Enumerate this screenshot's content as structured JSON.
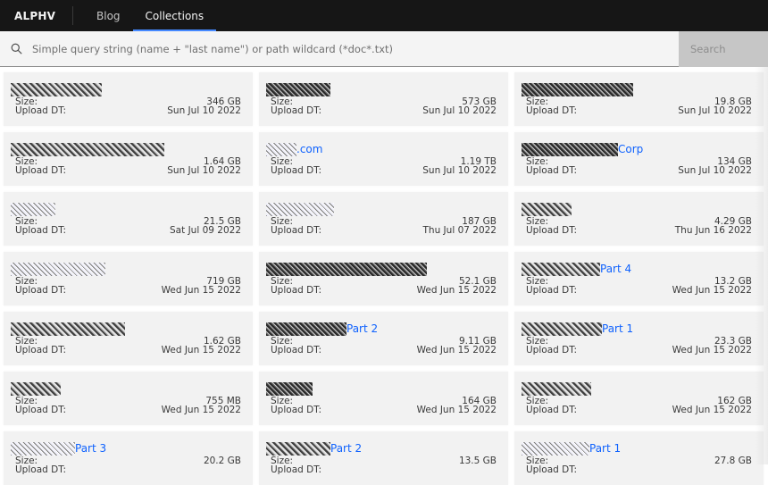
{
  "header": {
    "brand": "ALPHV",
    "nav": [
      {
        "label": "Blog",
        "active": false
      },
      {
        "label": "Collections",
        "active": true
      }
    ],
    "accent_color": "#4589ff"
  },
  "search": {
    "icon": "search-icon",
    "placeholder": "Simple query string (name + \"last name\") or path wildcard (*doc*.txt)",
    "value": "",
    "button_label": "Search"
  },
  "labels": {
    "size": "Size:",
    "upload": "Upload DT:"
  },
  "collections": [
    {
      "name_redacted": true,
      "suffix": "",
      "size": "346 GB",
      "upload": "Sun Jul 10 2022"
    },
    {
      "name_redacted": true,
      "suffix": "",
      "size": "573 GB",
      "upload": "Sun Jul 10 2022"
    },
    {
      "name_redacted": true,
      "suffix": "",
      "size": "19.8 GB",
      "upload": "Sun Jul 10 2022"
    },
    {
      "name_redacted": true,
      "suffix": "",
      "size": "1.64 GB",
      "upload": "Sun Jul 10 2022"
    },
    {
      "name_redacted": true,
      "suffix": ".com",
      "size": "1.19 TB",
      "upload": "Sun Jul 10 2022"
    },
    {
      "name_redacted": true,
      "suffix": "Corp",
      "size": "134 GB",
      "upload": "Sun Jul 10 2022"
    },
    {
      "name_redacted": true,
      "suffix": "",
      "size": "21.5 GB",
      "upload": "Sat Jul 09 2022"
    },
    {
      "name_redacted": true,
      "suffix": "",
      "size": "187 GB",
      "upload": "Thu Jul 07 2022"
    },
    {
      "name_redacted": true,
      "suffix": "",
      "size": "4.29 GB",
      "upload": "Thu Jun 16 2022"
    },
    {
      "name_redacted": true,
      "suffix": "",
      "size": "719 GB",
      "upload": "Wed Jun 15 2022"
    },
    {
      "name_redacted": true,
      "suffix": "",
      "size": "52.1 GB",
      "upload": "Wed Jun 15 2022"
    },
    {
      "name_redacted": true,
      "suffix": "Part 4",
      "size": "13.2 GB",
      "upload": "Wed Jun 15 2022"
    },
    {
      "name_redacted": true,
      "suffix": "",
      "size": "1.62 GB",
      "upload": "Wed Jun 15 2022"
    },
    {
      "name_redacted": true,
      "suffix": "Part 2",
      "size": "9.11 GB",
      "upload": "Wed Jun 15 2022"
    },
    {
      "name_redacted": true,
      "suffix": "Part 1",
      "size": "23.3 GB",
      "upload": "Wed Jun 15 2022"
    },
    {
      "name_redacted": true,
      "suffix": "",
      "size": "755 MB",
      "upload": "Wed Jun 15 2022"
    },
    {
      "name_redacted": true,
      "suffix": "",
      "size": "164 GB",
      "upload": "Wed Jun 15 2022"
    },
    {
      "name_redacted": true,
      "suffix": "",
      "size": "162 GB",
      "upload": "Wed Jun 15 2022"
    },
    {
      "name_redacted": true,
      "suffix": "Part 3",
      "size": "20.2 GB",
      "upload": ""
    },
    {
      "name_redacted": true,
      "suffix": "Part 2",
      "size": "13.5 GB",
      "upload": ""
    },
    {
      "name_redacted": true,
      "suffix": "Part 1",
      "size": "27.8 GB",
      "upload": ""
    }
  ]
}
